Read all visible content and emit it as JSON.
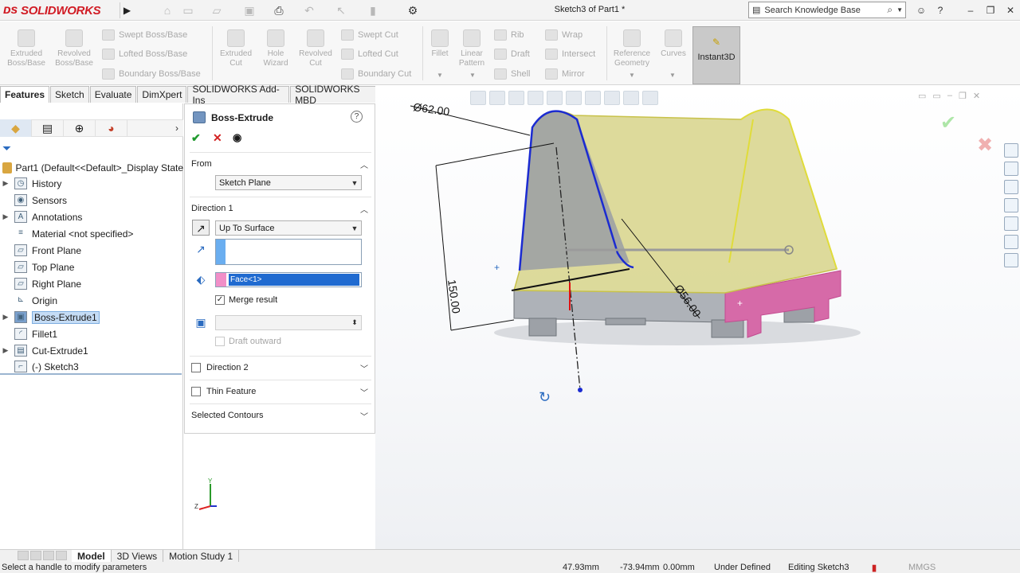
{
  "app": {
    "logo_text": "SOLIDWORKS",
    "title": "Sketch3 of Part1 *",
    "search_placeholder": "Search Knowledge Base"
  },
  "command_manager": {
    "big_buttons": [
      {
        "id": "extruded-boss",
        "label_line1": "Extruded",
        "label_line2": "Boss/Base"
      },
      {
        "id": "revolved-boss",
        "label_line1": "Revolved",
        "label_line2": "Boss/Base"
      },
      {
        "id": "extruded-cut",
        "label_line1": "Extruded",
        "label_line2": "Cut"
      },
      {
        "id": "hole-wizard",
        "label_line1": "Hole",
        "label_line2": "Wizard"
      },
      {
        "id": "revolved-cut",
        "label_line1": "Revolved",
        "label_line2": "Cut"
      },
      {
        "id": "fillet",
        "label_line1": "Fillet",
        "label_line2": ""
      },
      {
        "id": "linear-pattern",
        "label_line1": "Linear",
        "label_line2": "Pattern"
      },
      {
        "id": "reference-geometry",
        "label_line1": "Reference",
        "label_line2": "Geometry"
      },
      {
        "id": "curves",
        "label_line1": "Curves",
        "label_line2": ""
      }
    ],
    "small_buttons": {
      "swept_boss": "Swept Boss/Base",
      "lofted_boss": "Lofted Boss/Base",
      "boundary_boss": "Boundary Boss/Base",
      "swept_cut": "Swept Cut",
      "lofted_cut": "Lofted Cut",
      "boundary_cut": "Boundary Cut",
      "rib": "Rib",
      "draft": "Draft",
      "shell": "Shell",
      "wrap": "Wrap",
      "intersect": "Intersect",
      "mirror": "Mirror"
    },
    "instant3d": "Instant3D"
  },
  "cmd_tabs": [
    "Features",
    "Sketch",
    "Evaluate",
    "DimXpert",
    "SOLIDWORKS Add-Ins",
    "SOLIDWORKS MBD"
  ],
  "tree": {
    "part": "Part1  (Default<<Default>_Display State",
    "items": [
      {
        "label": "History",
        "expandable": true,
        "icon": "history-icon"
      },
      {
        "label": "Sensors",
        "expandable": false,
        "icon": "sensors-icon"
      },
      {
        "label": "Annotations",
        "expandable": true,
        "icon": "annotations-icon"
      },
      {
        "label": "Material <not specified>",
        "expandable": false,
        "icon": "material-icon"
      },
      {
        "label": "Front Plane",
        "expandable": false,
        "icon": "plane-icon"
      },
      {
        "label": "Top Plane",
        "expandable": false,
        "icon": "plane-icon"
      },
      {
        "label": "Right Plane",
        "expandable": false,
        "icon": "plane-icon"
      },
      {
        "label": "Origin",
        "expandable": false,
        "icon": "origin-icon"
      },
      {
        "label": "Boss-Extrude1",
        "expandable": true,
        "icon": "extrude-icon",
        "selected": true
      },
      {
        "label": "Fillet1",
        "expandable": false,
        "icon": "fillet-icon"
      },
      {
        "label": "Cut-Extrude1",
        "expandable": true,
        "icon": "cut-extrude-icon"
      },
      {
        "label": "(-) Sketch3",
        "expandable": false,
        "icon": "sketch-icon"
      }
    ]
  },
  "property_manager": {
    "title": "Boss-Extrude",
    "from": {
      "header": "From",
      "value": "Sketch Plane"
    },
    "direction1": {
      "header": "Direction 1",
      "end_condition": "Up To Surface",
      "face": "Face<1>",
      "merge_result": "Merge result",
      "draft_outward": "Draft outward"
    },
    "direction2": "Direction 2",
    "thin_feature": "Thin Feature",
    "selected_contours": "Selected Contours"
  },
  "graphics": {
    "dim_diameter_top": "Ø62.00",
    "dim_height": "150.00",
    "dim_diameter_side": "Ø56.00"
  },
  "model_tabs": [
    "Model",
    "3D Views",
    "Motion Study 1"
  ],
  "status": {
    "message": "Select a handle to modify parameters",
    "x": "47.93mm",
    "y": "-73.94mm",
    "z": "0.00mm",
    "state": "Under Defined",
    "editing": "Editing Sketch3",
    "units": "MMGS"
  },
  "colors": {
    "accent": "#d11b24",
    "selection": "#1f6ad0",
    "model_face": "#d7d48a",
    "pink_face": "#d66aa8"
  }
}
